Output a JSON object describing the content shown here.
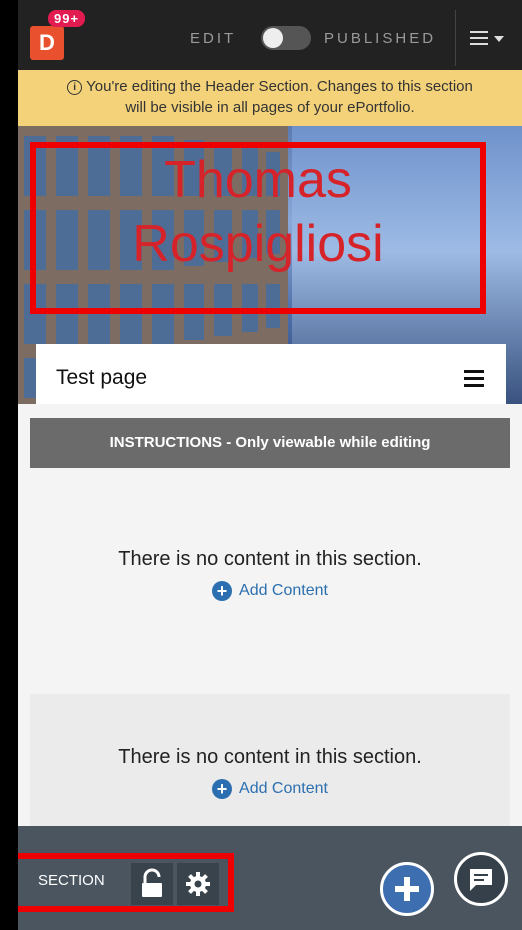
{
  "topbar": {
    "logo": "D",
    "notification_count": "99+",
    "edit_label": "EDIT",
    "published_label": "PUBLISHED",
    "menu_icon": "hamburger-caret-icon"
  },
  "banner": {
    "line1": "You're editing the Header Section. Changes to this section",
    "line2": "will be visible in all pages of your ePortfolio.",
    "icon": "info-icon"
  },
  "header": {
    "name_line1": "Thomas",
    "name_line2": "Rospigliosi",
    "page_title": "Test page"
  },
  "sections": [
    {
      "instructions": "INSTRUCTIONS - Only viewable while editing",
      "message": "There is no content in this section.",
      "add_label": "Add Content"
    },
    {
      "message": "There is no content in this section.",
      "add_label": "Add Content"
    }
  ],
  "bottombar": {
    "section_label": "SECTION",
    "icons": [
      "unlock-icon",
      "gear-icon",
      "add-icon",
      "chat-icon"
    ]
  },
  "colors": {
    "accent": "#2c6fb0",
    "logo": "#e8502e",
    "badge": "#e21b51",
    "banner": "#f3d27a",
    "highlight": "#ee0000",
    "name": "#d6232a"
  }
}
